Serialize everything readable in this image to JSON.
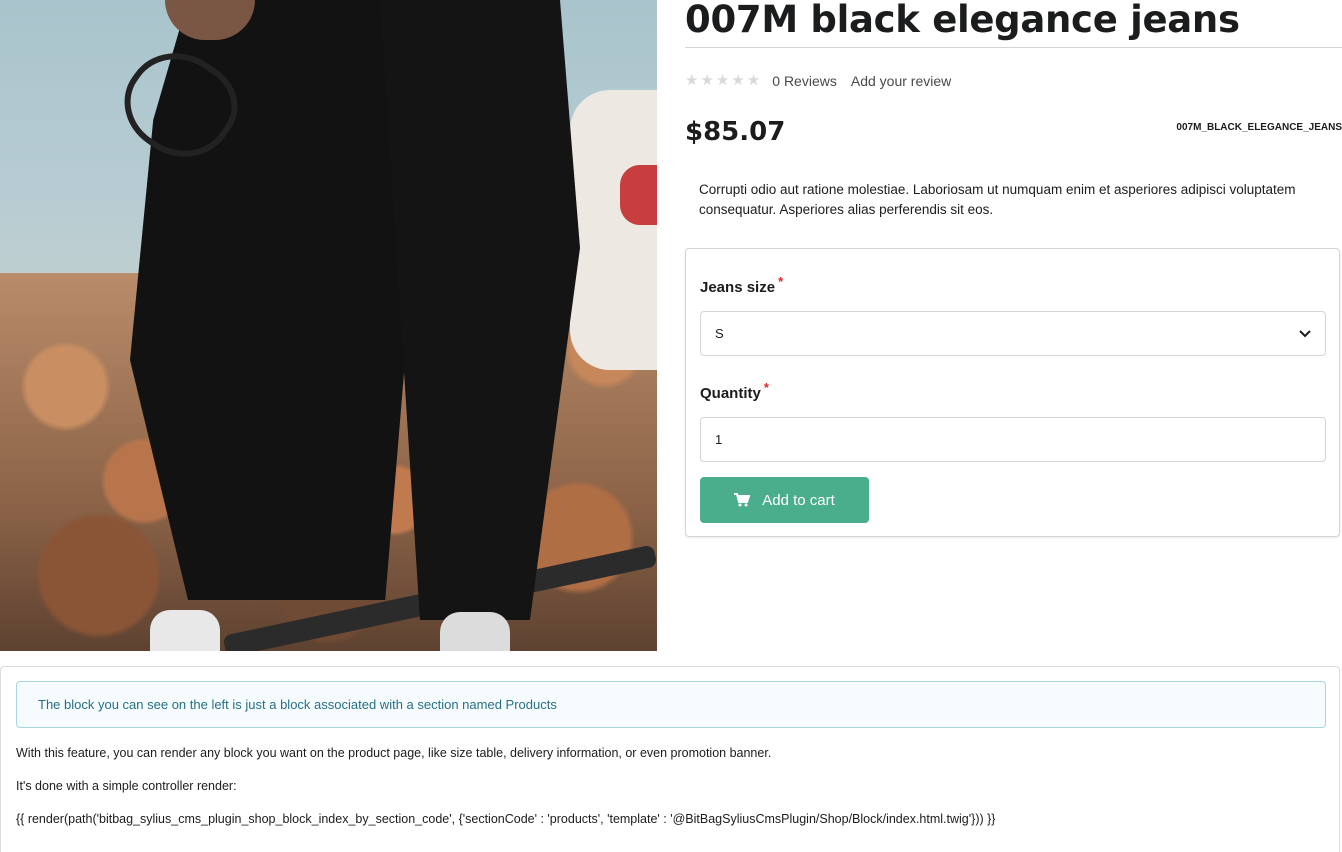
{
  "product": {
    "title": "007M black elegance jeans",
    "reviews_label": "0 Reviews",
    "add_review_label": "Add your review",
    "rating_stars": 0,
    "rating_max": 5,
    "price": "$85.07",
    "sku": "007M_BLACK_ELEGANCE_JEANS",
    "description": "Corrupti odio aut ratione molestiae. Laboriosam ut numquam enim et asperiores adipisci voluptatem consequatur. Asperiores alias perferendis sit eos."
  },
  "cart_form": {
    "size_label": "Jeans size",
    "size_value": "S",
    "quantity_label": "Quantity",
    "quantity_value": "1",
    "required_mark": "*",
    "add_to_cart_label": "Add to cart"
  },
  "cms_block": {
    "notice": "The block you can see on the left is just a block associated with a section named Products",
    "line1": "With this feature, you can render any block you want on the product page, like size table, delivery information, or even promotion banner.",
    "line2": "It's done with a simple controller render:",
    "line3": "{{ render(path('bitbag_sylius_cms_plugin_shop_block_index_by_section_code', {'sectionCode' : 'products', 'template' : '@BitBagSyliusCmsPlugin/Shop/Block/index.html.twig'})) }}"
  },
  "colors": {
    "accent": "#4aae8c",
    "required": "#db2828",
    "notice_text": "#276f86",
    "notice_bg": "#f6fcfd"
  },
  "icons": {
    "star": "star-icon",
    "cart": "cart-icon",
    "select_chevron": "chevron-down-icon"
  }
}
